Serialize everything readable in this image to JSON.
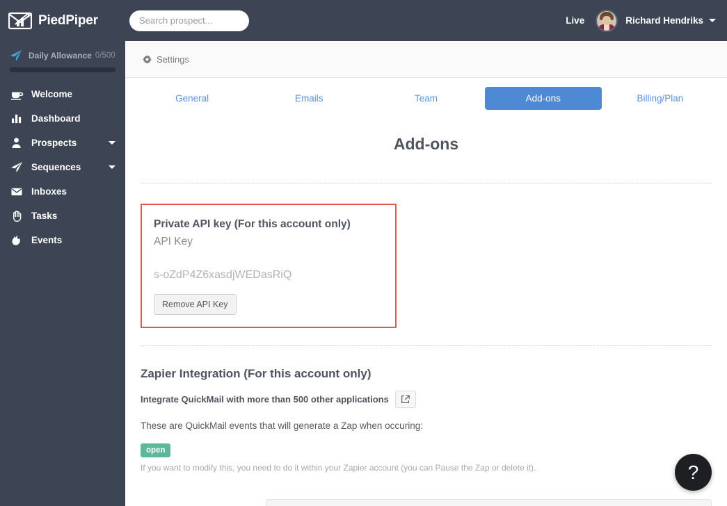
{
  "header": {
    "brand": "PiedPiper",
    "brand_logo_icon": "envelope-chart-logo-icon",
    "search": {
      "placeholder": "Search prospect...",
      "value": "",
      "icon": "search-icon"
    },
    "live_label": "Live",
    "user_name": "Richard Hendriks",
    "avatar_icon": "user-avatar-photo",
    "caret_icon": "caret-down-icon"
  },
  "sidebar": {
    "allowance": {
      "icon": "paper-plane-icon",
      "label": "Daily Allowance",
      "count": "0/500",
      "percent": 0
    },
    "items": [
      {
        "label": "Welcome",
        "icon": "coffee-cup-icon",
        "caret": false
      },
      {
        "label": "Dashboard",
        "icon": "bar-chart-icon",
        "caret": false
      },
      {
        "label": "Prospects",
        "icon": "person-icon",
        "caret": true
      },
      {
        "label": "Sequences",
        "icon": "paper-plane-icon",
        "caret": true
      },
      {
        "label": "Inboxes",
        "icon": "envelope-icon",
        "caret": false
      },
      {
        "label": "Tasks",
        "icon": "hand-icon",
        "caret": false
      },
      {
        "label": "Events",
        "icon": "flame-icon",
        "caret": false
      }
    ]
  },
  "breadcrumb": {
    "icon": "gear-icon",
    "text": "Settings"
  },
  "tabs": [
    {
      "label": "General",
      "active": false
    },
    {
      "label": "Emails",
      "active": false
    },
    {
      "label": "Team",
      "active": false
    },
    {
      "label": "Add-ons",
      "active": true
    },
    {
      "label": "Billing/Plan",
      "active": false
    }
  ],
  "main": {
    "page_title": "Add-ons",
    "api_card": {
      "title": "Private API key (For this account only)",
      "field_label": "API Key",
      "key_value": "s-oZdP4Z6xasdjWEDasRiQ",
      "remove_button": "Remove API Key",
      "border_color": "#e8564a"
    },
    "zapier": {
      "title": "Zapier Integration (For this account only)",
      "subtitle": "Integrate QuickMail with more than 500 other applications",
      "external_link_icon": "external-link-icon",
      "description": "These are QuickMail events that will generate a Zap when occuring:",
      "badge": "open",
      "badge_color": "#5cb89a",
      "note": "If you want to modify this, you need to do it within your Zapier account (you can Pause the Zap or delete it)."
    }
  },
  "help_button": {
    "label": "?",
    "icon": "question-mark-icon"
  },
  "colors": {
    "sidebar_bg": "#3d4453",
    "accent_blue": "#4e8ad4",
    "link_blue": "#5b93dd",
    "allowance_blue": "#4aa3e0"
  }
}
